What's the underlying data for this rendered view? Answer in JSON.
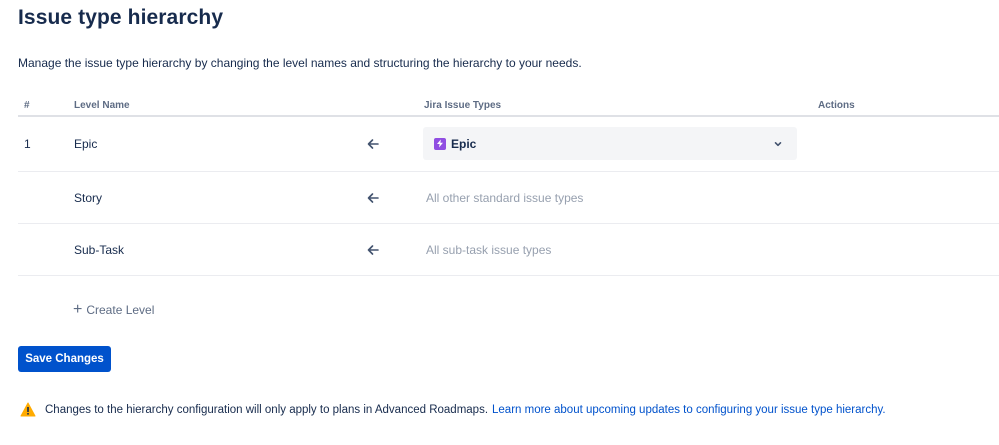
{
  "page": {
    "title": "Issue type hierarchy",
    "description": "Manage the issue type hierarchy by changing the level names and structuring the hierarchy to your needs."
  },
  "table": {
    "headers": {
      "number": "#",
      "level_name": "Level Name",
      "issue_types": "Jira Issue Types",
      "actions": "Actions"
    },
    "rows": [
      {
        "number": "1",
        "name": "Epic",
        "issue_type_selected": "Epic",
        "issue_type_icon": "epic-icon"
      },
      {
        "number": "",
        "name": "Story",
        "issue_type_text": "All other standard issue types"
      },
      {
        "number": "",
        "name": "Sub-Task",
        "issue_type_text": "All sub-task issue types"
      }
    ]
  },
  "actions": {
    "create_level": "Create Level",
    "save_changes": "Save Changes"
  },
  "notice": {
    "text": "Changes to the hierarchy configuration will only apply to plans in Advanced Roadmaps.",
    "link": "Learn more about upcoming updates to configuring your issue type hierarchy."
  },
  "colors": {
    "primary": "#0052cc",
    "epic": "#904ee2",
    "warning": "#ffab00",
    "text": "#172b4d",
    "muted": "#97a0af"
  }
}
